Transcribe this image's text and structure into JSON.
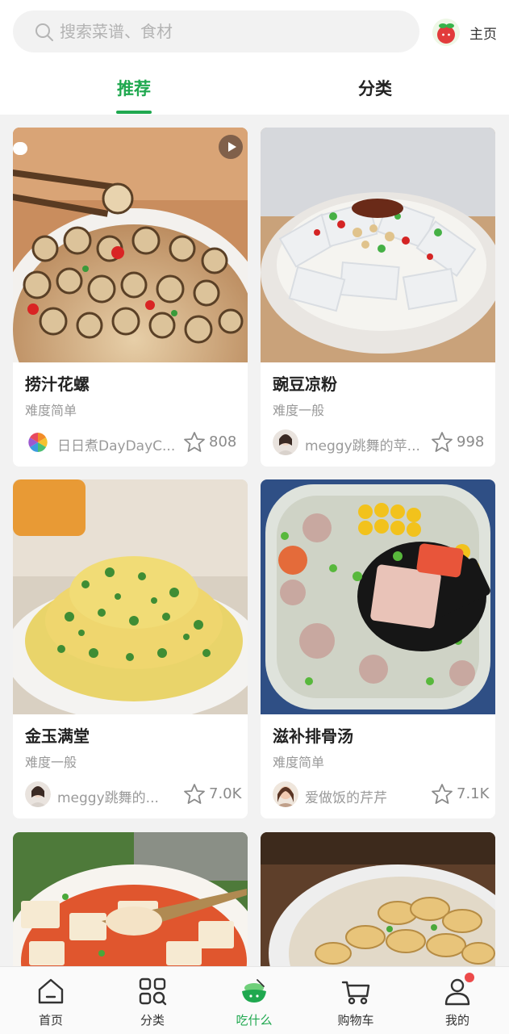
{
  "search": {
    "placeholder": "搜索菜谱、食材"
  },
  "header": {
    "home_label": "主页"
  },
  "tabs": [
    {
      "label": "推荐",
      "active": true
    },
    {
      "label": "分类",
      "active": false
    }
  ],
  "recipes": [
    {
      "title": "捞汁花螺",
      "difficulty": "难度简单",
      "author": "日日煮DayDayC...",
      "likes": "808",
      "has_video": true
    },
    {
      "title": "豌豆凉粉",
      "difficulty": "难度一般",
      "author": "meggy跳舞的苹...",
      "likes": "998",
      "has_video": false
    },
    {
      "title": "金玉满堂",
      "difficulty": "难度一般",
      "author": "meggy跳舞的...",
      "likes": "7.0K",
      "has_video": false
    },
    {
      "title": "滋补排骨汤",
      "difficulty": "难度简单",
      "author": "爱做饭的芹芹",
      "likes": "7.1K",
      "has_video": false
    },
    {
      "title": "",
      "difficulty": "",
      "author": "",
      "likes": "",
      "has_video": false
    },
    {
      "title": "",
      "difficulty": "",
      "author": "",
      "likes": "",
      "has_video": false
    }
  ],
  "bottom_nav": [
    {
      "label": "首页",
      "icon": "home-icon",
      "active": false
    },
    {
      "label": "分类",
      "icon": "grid-search-icon",
      "active": false
    },
    {
      "label": "吃什么",
      "icon": "bowl-icon",
      "active": true
    },
    {
      "label": "购物车",
      "icon": "cart-icon",
      "active": false
    },
    {
      "label": "我的",
      "icon": "user-icon",
      "active": false,
      "badge": true
    }
  ],
  "colors": {
    "accent": "#1fa84f",
    "badge": "#ec4a4a"
  }
}
